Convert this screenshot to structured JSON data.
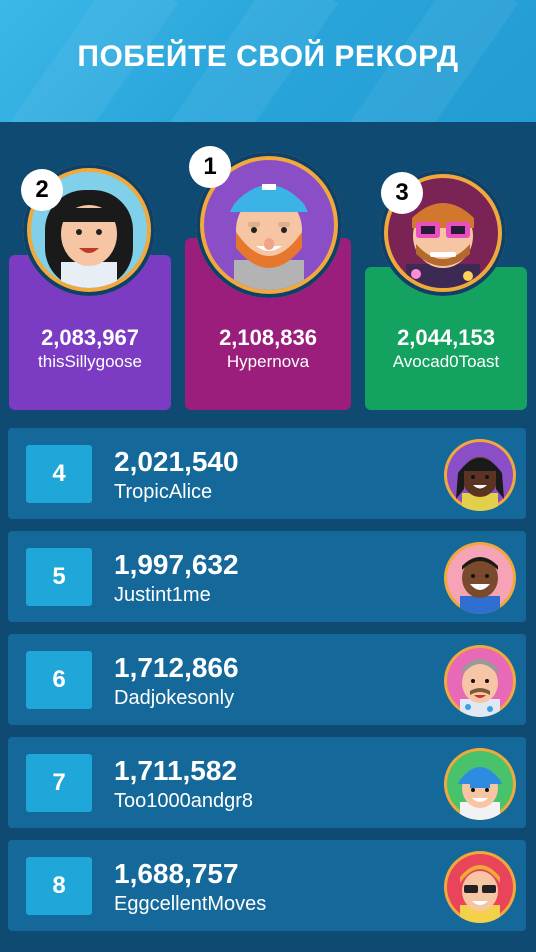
{
  "header": {
    "title": "ПОБЕЙТЕ СВОЙ РЕКОРД"
  },
  "podium": [
    {
      "rank": "2",
      "score": "2,083,967",
      "name": "thisSillygoose",
      "color": "#7b3bc2"
    },
    {
      "rank": "1",
      "score": "2,108,836",
      "name": "Hypernova",
      "color": "#9b1e7d"
    },
    {
      "rank": "3",
      "score": "2,044,153",
      "name": "Avocad0Toast",
      "color": "#13a25f"
    }
  ],
  "rows": [
    {
      "rank": "4",
      "score": "2,021,540",
      "name": "TropicAlice"
    },
    {
      "rank": "5",
      "score": "1,997,632",
      "name": "Justint1me"
    },
    {
      "rank": "6",
      "score": "1,712,866",
      "name": "Dadjokesonly"
    },
    {
      "rank": "7",
      "score": "1,711,582",
      "name": "Too1000andgr8"
    },
    {
      "rank": "8",
      "score": "1,688,757",
      "name": "EggcellentMoves"
    }
  ],
  "icons": {
    "rank2_avatar": "woman-black-hair-avatar-icon",
    "rank1_avatar": "man-cap-beard-avatar-icon",
    "rank3_avatar": "man-pink-sunglasses-avatar-icon",
    "row4_avatar": "woman-dark-hair-avatar-icon",
    "row5_avatar": "man-smiling-avatar-icon",
    "row6_avatar": "older-man-avatar-icon",
    "row7_avatar": "man-blue-cap-avatar-icon",
    "row8_avatar": "man-sunglasses-avatar-icon"
  }
}
